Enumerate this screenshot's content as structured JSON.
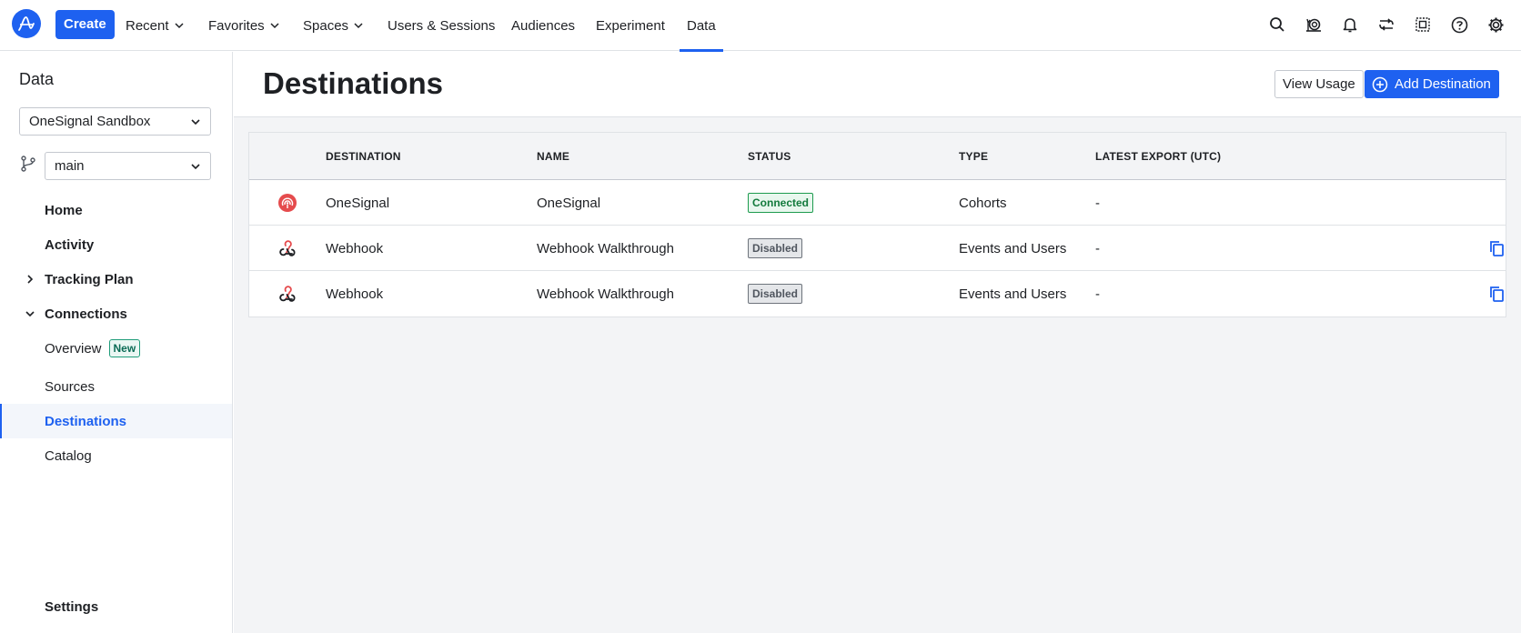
{
  "nav": {
    "create_label": "Create",
    "items": [
      {
        "label": "Recent",
        "dropdown": true
      },
      {
        "label": "Favorites",
        "dropdown": true
      },
      {
        "label": "Spaces",
        "dropdown": true
      },
      {
        "label": "Users & Sessions",
        "dropdown": false
      },
      {
        "label": "Audiences",
        "dropdown": false
      },
      {
        "label": "Experiment",
        "dropdown": false
      },
      {
        "label": "Data",
        "dropdown": false,
        "active": true
      }
    ],
    "icons": [
      "search-icon",
      "snail-icon",
      "bell-icon",
      "shuffle-icon",
      "grid-icon",
      "help-icon",
      "settings-gear-icon"
    ]
  },
  "sidebar": {
    "title": "Data",
    "project_select": "OneSignal Sandbox",
    "branch_select": "main",
    "items": [
      {
        "label": "Home"
      },
      {
        "label": "Activity"
      },
      {
        "label": "Tracking Plan",
        "toggle": "collapsed"
      },
      {
        "label": "Connections",
        "toggle": "expanded"
      },
      {
        "label": "Overview",
        "badge": "New"
      },
      {
        "label": "Sources"
      },
      {
        "label": "Destinations",
        "active": true
      },
      {
        "label": "Catalog"
      }
    ],
    "settings_label": "Settings"
  },
  "main": {
    "title": "Destinations",
    "view_usage_label": "View Usage",
    "add_destination_label": "Add Destination",
    "table": {
      "headers": [
        "DESTINATION",
        "NAME",
        "STATUS",
        "TYPE",
        "LATEST EXPORT (UTC)"
      ],
      "rows": [
        {
          "icon": "onesignal-icon",
          "destination": "OneSignal",
          "name": "OneSignal",
          "status": "Connected",
          "type": "Cohorts",
          "latest_export": "-",
          "copy": false
        },
        {
          "icon": "webhook-icon",
          "destination": "Webhook",
          "name": "Webhook Walkthrough",
          "status": "Disabled",
          "type": "Events and Users",
          "latest_export": "-",
          "copy": true
        },
        {
          "icon": "webhook-icon",
          "destination": "Webhook",
          "name": "Webhook Walkthrough",
          "status": "Disabled",
          "type": "Events and Users",
          "latest_export": "-",
          "copy": true
        }
      ]
    }
  },
  "colors": {
    "accent": "#1e61f0",
    "connected": "#1d9b4e",
    "disabled": "#6e747c",
    "onesignal": "#e54b4d"
  }
}
